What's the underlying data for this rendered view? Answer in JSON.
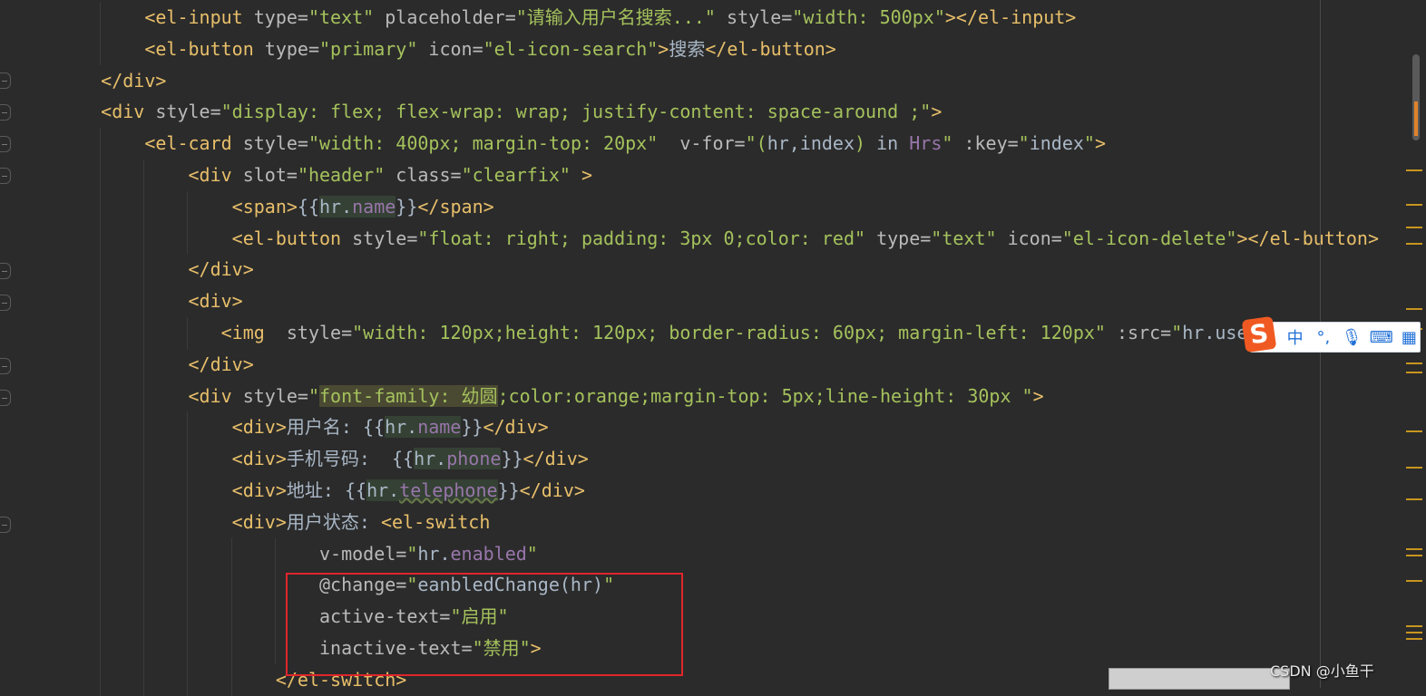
{
  "editor": {
    "lines": [
      {
        "indent": 8,
        "tokens": [
          [
            "t",
            "<el-input "
          ],
          [
            "a",
            "type="
          ],
          [
            "s",
            "\"text\""
          ],
          [
            "a",
            " placeholder="
          ],
          [
            "s",
            "\"请输入用户名搜索...\""
          ],
          [
            "a",
            " style="
          ],
          [
            "s",
            "\"width: 500px\""
          ],
          [
            "t",
            "></el-input>"
          ]
        ]
      },
      {
        "indent": 8,
        "tokens": [
          [
            "t",
            "<el-button "
          ],
          [
            "a",
            "type="
          ],
          [
            "s",
            "\"primary\""
          ],
          [
            "a",
            " icon="
          ],
          [
            "s",
            "\"el-icon-search\""
          ],
          [
            "t",
            ">"
          ],
          [
            "x",
            "搜索"
          ],
          [
            "t",
            "</el-button>"
          ]
        ]
      },
      {
        "indent": 4,
        "tokens": [
          [
            "t",
            "</div>"
          ]
        ]
      },
      {
        "indent": 4,
        "tokens": [
          [
            "t",
            "<div "
          ],
          [
            "a",
            "style="
          ],
          [
            "s",
            "\"display: flex; flex-wrap: wrap; justify-content: space-around ;\""
          ],
          [
            "t",
            ">"
          ]
        ]
      },
      {
        "indent": 8,
        "tokens": [
          [
            "t",
            "<el-card "
          ],
          [
            "a",
            "style="
          ],
          [
            "s",
            "\"width: 400px; margin-top: 20px\""
          ],
          [
            "a",
            "  v-for="
          ],
          [
            "s",
            "\"("
          ],
          [
            "x",
            "hr,index"
          ],
          [
            "s",
            ") "
          ],
          [
            "x",
            "in "
          ],
          [
            "p",
            "Hrs"
          ],
          [
            "s",
            "\""
          ],
          [
            "a",
            " :key="
          ],
          [
            "s",
            "\""
          ],
          [
            "x",
            "index"
          ],
          [
            "s",
            "\""
          ],
          [
            "t",
            ">"
          ]
        ]
      },
      {
        "indent": 12,
        "tokens": [
          [
            "t",
            "<div "
          ],
          [
            "a",
            "slot="
          ],
          [
            "s",
            "\"header\""
          ],
          [
            "a",
            " class="
          ],
          [
            "s",
            "\"clearfix\""
          ],
          [
            "t",
            " >"
          ]
        ]
      },
      {
        "indent": 16,
        "tokens": [
          [
            "t",
            "<span>"
          ],
          [
            "b",
            "{{"
          ],
          [
            "x",
            "hr.",
            "hi"
          ],
          [
            "p",
            "name",
            "hi"
          ],
          [
            "b",
            "}}"
          ],
          [
            "t",
            "</span>"
          ]
        ]
      },
      {
        "indent": 16,
        "tokens": [
          [
            "t",
            "<el-button "
          ],
          [
            "a",
            "style="
          ],
          [
            "s",
            "\"float: right; padding: 3px 0;color: red\""
          ],
          [
            "a",
            " type="
          ],
          [
            "s",
            "\"text\""
          ],
          [
            "a",
            " icon="
          ],
          [
            "s",
            "\"el-icon-delete\""
          ],
          [
            "t",
            "></el-button>"
          ]
        ]
      },
      {
        "indent": 12,
        "tokens": [
          [
            "t",
            "</div>"
          ]
        ]
      },
      {
        "indent": 12,
        "tokens": [
          [
            "t",
            "<div>"
          ]
        ]
      },
      {
        "indent": 15,
        "tokens": [
          [
            "t",
            "<img  "
          ],
          [
            "a",
            "style="
          ],
          [
            "s",
            "\"width: 120px;height: 120px; border-radius: 60px; margin-left: 120px\""
          ],
          [
            "a",
            " :src="
          ],
          [
            "s",
            "\""
          ],
          [
            "x",
            "hr.user"
          ]
        ]
      },
      {
        "indent": 12,
        "tokens": [
          [
            "t",
            "</div>"
          ]
        ]
      },
      {
        "indent": 12,
        "tokens": [
          [
            "t",
            "<div "
          ],
          [
            "a",
            "style="
          ],
          [
            "s",
            "\""
          ],
          [
            "s",
            "font-family: 幼圆",
            "hl"
          ],
          [
            "s",
            ";color:orange;margin-top: 5px;line-height: 30px \""
          ],
          [
            "t",
            ">"
          ]
        ]
      },
      {
        "indent": 16,
        "tokens": [
          [
            "t",
            "<div>"
          ],
          [
            "x",
            "用户名: "
          ],
          [
            "b",
            "{{"
          ],
          [
            "x",
            "hr.",
            "hi"
          ],
          [
            "p",
            "name",
            "hi"
          ],
          [
            "b",
            "}}"
          ],
          [
            "t",
            "</div>"
          ]
        ]
      },
      {
        "indent": 16,
        "tokens": [
          [
            "t",
            "<div>"
          ],
          [
            "x",
            "手机号码:  "
          ],
          [
            "b",
            "{{"
          ],
          [
            "x",
            "hr.",
            "hi"
          ],
          [
            "p",
            "phone",
            "hi"
          ],
          [
            "b",
            "}}"
          ],
          [
            "t",
            "</div>"
          ]
        ]
      },
      {
        "indent": 16,
        "tokens": [
          [
            "t",
            "<div>"
          ],
          [
            "x",
            "地址: "
          ],
          [
            "b",
            "{{"
          ],
          [
            "x",
            "hr.",
            "hi"
          ],
          [
            "p",
            "telephone",
            "hi"
          ],
          [
            "b",
            "}}"
          ],
          [
            "t",
            "</div>"
          ]
        ]
      },
      {
        "indent": 16,
        "tokens": [
          [
            "t",
            "<div>"
          ],
          [
            "x",
            "用户状态: "
          ],
          [
            "t",
            "<el-switch"
          ]
        ]
      },
      {
        "indent": 24,
        "tokens": [
          [
            "a",
            "v-model="
          ],
          [
            "s",
            "\""
          ],
          [
            "x",
            "hr."
          ],
          [
            "p",
            "enabled"
          ],
          [
            "s",
            "\""
          ]
        ]
      },
      {
        "indent": 24,
        "tokens": [
          [
            "a",
            "@change="
          ],
          [
            "s",
            "\""
          ],
          [
            "x",
            "eanbledChange(hr)"
          ],
          [
            "s",
            "\""
          ]
        ]
      },
      {
        "indent": 24,
        "tokens": [
          [
            "a",
            "active-text="
          ],
          [
            "s",
            "\"启用\""
          ]
        ]
      },
      {
        "indent": 24,
        "tokens": [
          [
            "a",
            "inactive-text="
          ],
          [
            "s",
            "\"禁用\""
          ],
          [
            "t",
            ">"
          ]
        ]
      },
      {
        "indent": 20,
        "tokens": [
          [
            "t",
            "</el-switch>"
          ]
        ]
      }
    ]
  },
  "ime_toolbar": {
    "logo": "S",
    "lang": "中",
    "punct": "°,",
    "icons": [
      "microphone-icon",
      "keyboard-icon",
      "apps-icon"
    ]
  },
  "watermark": "CSDN @小鱼干",
  "colors": {
    "background": "#2b2b2b",
    "tag": "#e8bf6a",
    "attribute": "#bababa",
    "string": "#a5c25c",
    "text": "#a9b7c6",
    "field": "#9876aa",
    "highlight_box": "#e0262b"
  }
}
